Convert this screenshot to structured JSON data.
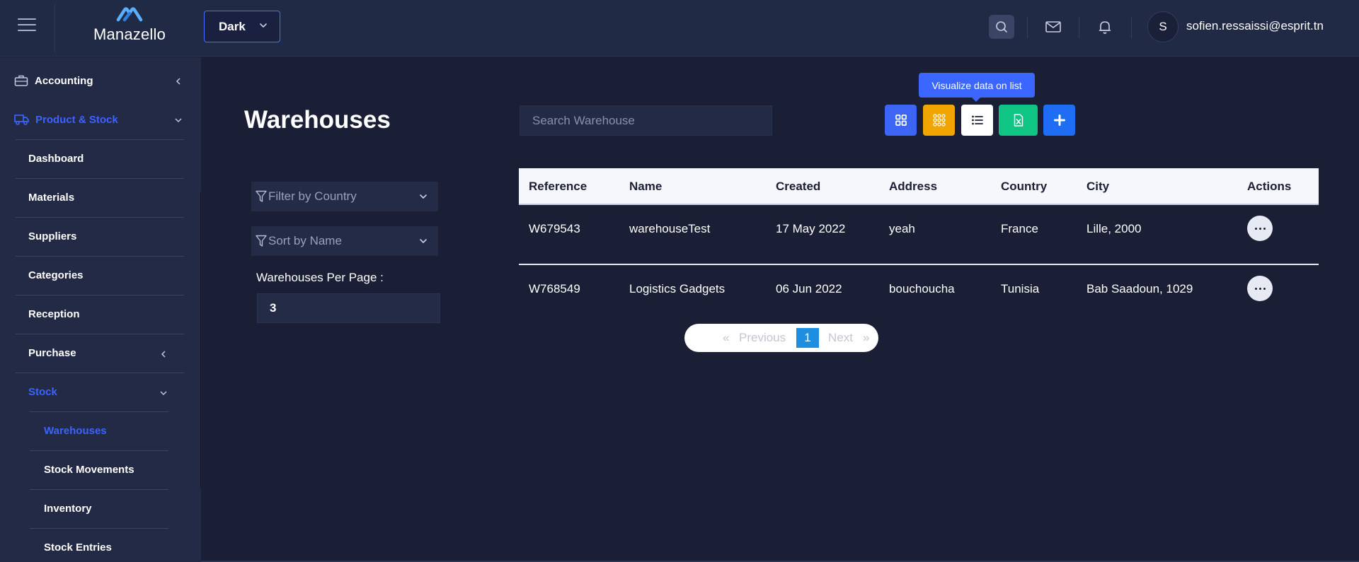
{
  "header": {
    "app_name": "Manazello",
    "theme_select_value": "Dark",
    "user_initial": "S",
    "user_email": "sofien.ressaissi@esprit.tn",
    "icons": [
      "menu-icon",
      "search-icon",
      "mail-icon",
      "bell-icon"
    ]
  },
  "sidebar": {
    "items": [
      {
        "label": "Accounting",
        "icon": "briefcase-icon",
        "chevron": "left"
      },
      {
        "label": "Product & Stock",
        "icon": "truck-icon",
        "chevron": "down",
        "active": true
      },
      {
        "label": "Dashboard"
      },
      {
        "label": "Materials"
      },
      {
        "label": "Suppliers"
      },
      {
        "label": "Categories"
      },
      {
        "label": "Reception"
      },
      {
        "label": "Purchase",
        "chevron": "left"
      },
      {
        "label": "Stock",
        "chevron": "down",
        "active": true
      },
      {
        "label": "Warehouses",
        "active": true
      },
      {
        "label": "Stock Movements"
      },
      {
        "label": "Inventory"
      },
      {
        "label": "Stock Entries"
      }
    ]
  },
  "main": {
    "title": "Warehouses",
    "search_placeholder": "Search Warehouse",
    "tooltip": "Visualize data on list",
    "toolbar": [
      "grid-view-icon",
      "dots-grid-icon",
      "list-view-icon",
      "excel-export-icon",
      "add-icon"
    ],
    "filters": {
      "country_label": "Filter by Country",
      "sort_label": "Sort by Name",
      "per_page_label": "Warehouses Per Page :",
      "per_page_value": "3"
    },
    "table": {
      "columns": [
        "Reference",
        "Name",
        "Created",
        "Address",
        "Country",
        "City",
        "Actions"
      ],
      "rows": [
        [
          "W679543",
          "warehouseTest",
          "17 May 2022",
          "yeah",
          "France",
          "Lille, 2000"
        ],
        [
          "W768549",
          "Logistics Gadgets",
          "06 Jun 2022",
          "bouchoucha",
          "Tunisia",
          "Bab Saadoun, 1029"
        ]
      ]
    },
    "pagination": {
      "first": "«",
      "previous": "Previous",
      "current": "1",
      "next": "Next",
      "last": "»"
    }
  },
  "colors": {
    "background": "#1a1f35",
    "panel": "#222a46",
    "accent": "#3d63ff",
    "warning": "#f0a500",
    "success": "#10c483"
  }
}
